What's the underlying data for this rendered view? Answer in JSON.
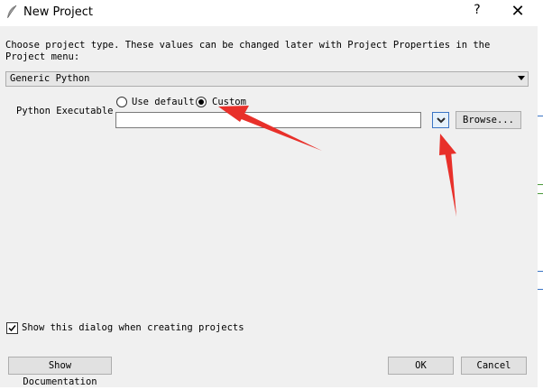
{
  "window": {
    "title": "New Project",
    "help_label": "?",
    "close_label": "✕",
    "icon": "feather-icon"
  },
  "project": {
    "description": "Choose project type.  These values can be changed later with Project Properties in the Project menu:",
    "type_selected": "Generic Python"
  },
  "executable": {
    "label": "Python Executable",
    "options": [
      "Use default",
      "Custom"
    ],
    "selected": "Custom",
    "value": "",
    "browse_label": "Browse..."
  },
  "footer": {
    "show_dialog_label": "Show this dialog when creating projects",
    "show_dialog_checked": true,
    "documentation_label": "Show Documentation",
    "ok_label": "OK",
    "cancel_label": "Cancel"
  },
  "colors": {
    "annotation_arrow": "#e8302a",
    "dropdown_highlight": "#3a74c4"
  }
}
